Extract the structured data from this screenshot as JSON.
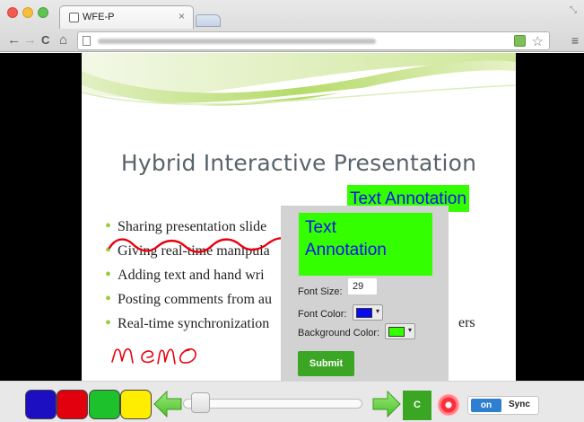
{
  "browser": {
    "tab_title": "WFE-P",
    "tab_close": "×",
    "icons": {
      "back": "←",
      "forward": "→",
      "reload": "C",
      "home": "⌂",
      "star": "☆",
      "menu": "≡",
      "resize": "⤡"
    }
  },
  "slide": {
    "title": "Hybrid Interactive Presentation",
    "bullets": [
      "Sharing presentation slide",
      "Giving real-time manipula",
      "Adding text and hand wri",
      "Posting comments from au",
      "Real-time synchronization"
    ],
    "bullet_trailing_text": "ers",
    "text_annotation": "Text Annotation",
    "handwriting": "memo",
    "colors": {
      "title": "#58646a",
      "bullet": "#9acb3c",
      "annotation_bg": "#33ff00",
      "annotation_text": "#1010ee",
      "ink": "#e8000f"
    }
  },
  "annotation_popup": {
    "preview_line1": "Text",
    "preview_line2": "Annotation",
    "font_size_label": "Font Size:",
    "font_size_value": "29",
    "font_color_label": "Font Color:",
    "font_color": "#0a0af0",
    "background_color_label": "Background Color:",
    "background_color": "#33ff00",
    "dropdown_arrow": "▾",
    "submit_label": "Submit"
  },
  "controls": {
    "pen_colors": [
      "#1c0fc2",
      "#e2000f",
      "#1cc12c",
      "#ffed00"
    ],
    "clear_label": "C",
    "toggle_state": "on",
    "toggle_label": "Sync",
    "slider_position": 0.05
  }
}
